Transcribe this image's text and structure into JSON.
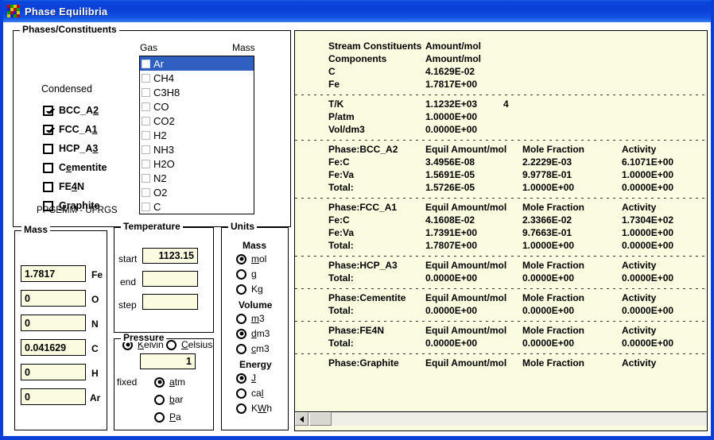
{
  "window": {
    "title": "Phase Equilibria",
    "icon": "phase-mosaic-icon",
    "border_color": "#0a3fd8",
    "titlebar_color": "#0b3fd6"
  },
  "phases_group": {
    "title": "Phases/Constituents",
    "condensed_label": "Condensed",
    "gas_label": "Gas",
    "mass_label": "Mass",
    "footer": "PPGEMM - UFRGS",
    "condensed": [
      {
        "label": "BCC_A2",
        "checked": true,
        "mnemonic_index": 5
      },
      {
        "label": "FCC_A1",
        "checked": true,
        "mnemonic_index": 5
      },
      {
        "label": "HCP_A3",
        "checked": false,
        "mnemonic_index": 5
      },
      {
        "label": "Cementite",
        "checked": false,
        "mnemonic_index": 2
      },
      {
        "label": "FE4N",
        "checked": false,
        "mnemonic_index": 2
      },
      {
        "label": "Graphite",
        "checked": false,
        "mnemonic_index": 0
      }
    ],
    "gas_items": [
      {
        "label": "Ar",
        "checked": false,
        "selected": true
      },
      {
        "label": "CH4",
        "checked": false,
        "selected": false
      },
      {
        "label": "C3H8",
        "checked": false,
        "selected": false
      },
      {
        "label": "CO",
        "checked": false,
        "selected": false
      },
      {
        "label": "CO2",
        "checked": false,
        "selected": false
      },
      {
        "label": "H2",
        "checked": false,
        "selected": false
      },
      {
        "label": "NH3",
        "checked": false,
        "selected": false
      },
      {
        "label": "H2O",
        "checked": false,
        "selected": false
      },
      {
        "label": "N2",
        "checked": false,
        "selected": false
      },
      {
        "label": "O2",
        "checked": false,
        "selected": false
      },
      {
        "label": "C",
        "checked": false,
        "selected": false
      }
    ]
  },
  "mass_group": {
    "title": "Mass",
    "fields": [
      {
        "value": "1.7817",
        "element": "Fe"
      },
      {
        "value": "0",
        "element": "O"
      },
      {
        "value": "0",
        "element": "N"
      },
      {
        "value": "0.041629",
        "element": "C"
      },
      {
        "value": "0",
        "element": "H"
      },
      {
        "value": "0",
        "element": "Ar"
      }
    ]
  },
  "temperature_group": {
    "title": "Temperature",
    "start_label": "start",
    "start_value": "1123.15",
    "end_label": "end",
    "end_value": "",
    "step_label": "step",
    "step_value": "",
    "scales": [
      {
        "label": "Kelvin",
        "selected": true,
        "mnemonic_index": 0
      },
      {
        "label": "Celsius",
        "selected": false,
        "mnemonic_index": 0
      }
    ]
  },
  "pressure_group": {
    "title": "Pressure",
    "value": "1",
    "fixed_label": "fixed",
    "units": [
      {
        "label": "atm",
        "selected": true,
        "mnemonic_index": 0
      },
      {
        "label": "bar",
        "selected": false,
        "mnemonic_index": 0
      },
      {
        "label": "Pa",
        "selected": false,
        "mnemonic_index": 0
      }
    ]
  },
  "units_group": {
    "title": "Units",
    "sections": [
      {
        "heading": "Mass",
        "options": [
          {
            "label": "mol",
            "selected": true,
            "mnemonic_index": 0
          },
          {
            "label": "g",
            "selected": false,
            "mnemonic_index": 0
          },
          {
            "label": "Kg",
            "selected": false,
            "mnemonic_index": 1
          }
        ]
      },
      {
        "heading": "Volume",
        "options": [
          {
            "label": "m3",
            "selected": false,
            "mnemonic_index": 0
          },
          {
            "label": "dm3",
            "selected": true,
            "mnemonic_index": 0
          },
          {
            "label": "cm3",
            "selected": false,
            "mnemonic_index": 0
          }
        ]
      },
      {
        "heading": "Energy",
        "options": [
          {
            "label": "J",
            "selected": true,
            "mnemonic_index": 0
          },
          {
            "label": "cal",
            "selected": false,
            "mnemonic_index": 2
          },
          {
            "label": "KWh",
            "selected": false,
            "mnemonic_index": 1
          }
        ]
      }
    ]
  },
  "results": {
    "background": "#fbfbe0",
    "blocks": [
      {
        "rows": [
          [
            "Stream Constituents",
            "Amount/mol",
            "",
            ""
          ],
          [
            "Components",
            "Amount/mol",
            "",
            ""
          ],
          [
            "C",
            "4.1629E-02",
            "",
            ""
          ],
          [
            "Fe",
            "1.7817E+00",
            "",
            ""
          ]
        ]
      },
      {
        "rows": [
          [
            "T/K",
            "1.1232E+03",
            "4",
            ""
          ],
          [
            "P/atm",
            "1.0000E+00",
            "",
            ""
          ],
          [
            "Vol/dm3",
            "0.0000E+00",
            "",
            ""
          ]
        ]
      },
      {
        "rows": [
          [
            "Phase:BCC_A2",
            "Equil Amount/mol",
            "Mole Fraction",
            "Activity"
          ],
          [
            "Fe:C",
            "3.4956E-08",
            "2.2229E-03",
            "6.1071E+00"
          ],
          [
            "Fe:Va",
            "1.5691E-05",
            "9.9778E-01",
            "1.0000E+00"
          ],
          [
            "Total:",
            "1.5726E-05",
            "1.0000E+00",
            "0.0000E+00"
          ]
        ]
      },
      {
        "rows": [
          [
            "Phase:FCC_A1",
            "Equil Amount/mol",
            "Mole Fraction",
            "Activity"
          ],
          [
            "Fe:C",
            "4.1608E-02",
            "2.3366E-02",
            "1.7304E+02"
          ],
          [
            "Fe:Va",
            "1.7391E+00",
            "9.7663E-01",
            "1.0000E+00"
          ],
          [
            "Total:",
            "1.7807E+00",
            "1.0000E+00",
            "0.0000E+00"
          ]
        ]
      },
      {
        "rows": [
          [
            "Phase:HCP_A3",
            "Equil Amount/mol",
            "Mole Fraction",
            "Activity"
          ],
          [
            "Total:",
            "0.0000E+00",
            "0.0000E+00",
            "0.0000E+00"
          ]
        ]
      },
      {
        "rows": [
          [
            "Phase:Cementite",
            "Equil Amount/mol",
            "Mole Fraction",
            "Activity"
          ],
          [
            "Total:",
            "0.0000E+00",
            "0.0000E+00",
            "0.0000E+00"
          ]
        ]
      },
      {
        "rows": [
          [
            "Phase:FE4N",
            "Equil Amount/mol",
            "Mole Fraction",
            "Activity"
          ],
          [
            "Total:",
            "0.0000E+00",
            "0.0000E+00",
            "0.0000E+00"
          ]
        ]
      },
      {
        "rows": [
          [
            "Phase:Graphite",
            "Equil Amount/mol",
            "Mole Fraction",
            "Activity"
          ]
        ]
      }
    ]
  },
  "scrollbar": {
    "left_arrow_icon": "scroll-left-arrow-icon"
  }
}
